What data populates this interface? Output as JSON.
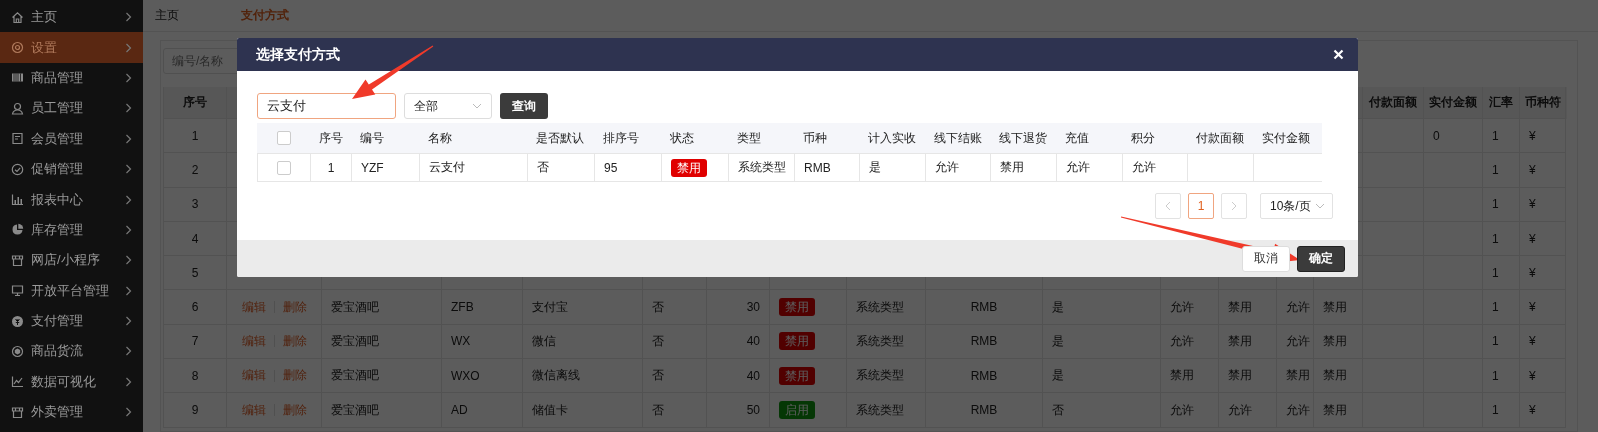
{
  "sidebar": {
    "items": [
      {
        "label": "主页",
        "selected": false
      },
      {
        "label": "设置",
        "selected": true
      },
      {
        "label": "商品管理",
        "selected": false
      },
      {
        "label": "员工管理",
        "selected": false
      },
      {
        "label": "会员管理",
        "selected": false
      },
      {
        "label": "促销管理",
        "selected": false
      },
      {
        "label": "报表中心",
        "selected": false
      },
      {
        "label": "库存管理",
        "selected": false
      },
      {
        "label": "网店/小程序",
        "selected": false
      },
      {
        "label": "开放平台管理",
        "selected": false
      },
      {
        "label": "支付管理",
        "selected": false
      },
      {
        "label": "商品货流",
        "selected": false
      },
      {
        "label": "数据可视化",
        "selected": false
      },
      {
        "label": "外卖管理",
        "selected": false
      }
    ]
  },
  "breadcrumb": [
    {
      "label": "主页",
      "current": false
    },
    {
      "label": "支付方式",
      "current": true
    }
  ],
  "filter": {
    "placeholder": "编号/名称"
  },
  "table": {
    "columns": [
      "序号",
      null,
      null,
      null,
      null,
      null,
      null,
      null,
      null,
      null,
      null,
      null,
      null,
      null,
      null,
      "付款面额",
      "实付金额",
      "汇率",
      "币种符"
    ],
    "rows": [
      {
        "cells": [
          "1",
          null,
          null,
          null,
          null,
          null,
          null,
          null,
          null,
          null,
          null,
          null,
          null,
          null,
          null,
          null,
          "0",
          "1",
          "¥"
        ]
      },
      {
        "cells": [
          "2",
          null,
          null,
          null,
          null,
          null,
          null,
          null,
          null,
          null,
          null,
          null,
          null,
          null,
          null,
          null,
          null,
          "1",
          "¥"
        ]
      },
      {
        "cells": [
          "3",
          null,
          null,
          null,
          null,
          null,
          null,
          null,
          null,
          null,
          null,
          null,
          null,
          null,
          null,
          null,
          null,
          "1",
          "¥"
        ]
      },
      {
        "cells": [
          "4",
          null,
          null,
          null,
          null,
          null,
          null,
          null,
          null,
          null,
          null,
          null,
          null,
          null,
          null,
          null,
          null,
          "1",
          "¥"
        ]
      },
      {
        "cells": [
          "5",
          null,
          null,
          null,
          null,
          null,
          null,
          null,
          null,
          null,
          null,
          null,
          null,
          null,
          null,
          null,
          null,
          "1",
          "¥"
        ]
      },
      {
        "cells": [
          "6",
          {
            "kind": "actions",
            "edit": "编辑",
            "delete": "删除"
          },
          "爱宝酒吧",
          "ZFB",
          "支付宝",
          "否",
          "30",
          {
            "kind": "status",
            "label": "禁用",
            "enabled": false
          },
          "系统类型",
          "RMB",
          "是",
          "允许",
          "禁用",
          "允许",
          "禁用",
          null,
          null,
          "1",
          "¥"
        ]
      },
      {
        "cells": [
          "7",
          {
            "kind": "actions",
            "edit": "编辑",
            "delete": "删除"
          },
          "爱宝酒吧",
          "WX",
          "微信",
          "否",
          "40",
          {
            "kind": "status",
            "label": "禁用",
            "enabled": false
          },
          "系统类型",
          "RMB",
          "是",
          "允许",
          "禁用",
          "允许",
          "禁用",
          null,
          null,
          "1",
          "¥"
        ]
      },
      {
        "cells": [
          "8",
          {
            "kind": "actions",
            "edit": "编辑",
            "delete": "删除"
          },
          "爱宝酒吧",
          "WXO",
          "微信离线",
          "否",
          "40",
          {
            "kind": "status",
            "label": "禁用",
            "enabled": false
          },
          "系统类型",
          "RMB",
          "是",
          "禁用",
          "禁用",
          "禁用",
          "禁用",
          null,
          null,
          "1",
          "¥"
        ]
      },
      {
        "cells": [
          "9",
          {
            "kind": "actions",
            "edit": "编辑",
            "delete": "删除"
          },
          "爱宝酒吧",
          "AD",
          "储值卡",
          "否",
          "50",
          {
            "kind": "status",
            "label": "启用",
            "enabled": true
          },
          "系统类型",
          "RMB",
          "否",
          "允许",
          "允许",
          "允许",
          "禁用",
          null,
          null,
          "1",
          "¥"
        ]
      }
    ]
  },
  "dialog": {
    "title": "选择支付方式",
    "search": {
      "value": "云支付"
    },
    "type_select": {
      "value": "全部"
    },
    "query_button": "查询",
    "table": {
      "columns": [
        {
          "kind": "checkbox",
          "checked": false
        },
        {
          "label": "序号"
        },
        {
          "label": "编号"
        },
        {
          "label": "名称"
        },
        {
          "label": "是否默认"
        },
        {
          "label": "排序号"
        },
        {
          "label": "状态"
        },
        {
          "label": "类型"
        },
        {
          "label": "币种"
        },
        {
          "label": "计入实收"
        },
        {
          "label": "线下结账"
        },
        {
          "label": "线下退货"
        },
        {
          "label": "充值"
        },
        {
          "label": "积分"
        },
        {
          "label": "付款面额"
        },
        {
          "label": "实付金额"
        }
      ],
      "rows": [
        {
          "cells": [
            {
              "kind": "checkbox",
              "checked": false
            },
            "1",
            "YZF",
            "云支付",
            "否",
            "95",
            {
              "kind": "status",
              "label": "禁用",
              "enabled": false
            },
            "系统类型",
            "RMB",
            "是",
            "允许",
            "禁用",
            "允许",
            "允许",
            null,
            null
          ]
        }
      ]
    },
    "pagination": {
      "pages": [
        {
          "label": "1",
          "selected": true
        }
      ],
      "page_size": "10条/页"
    },
    "buttons": [
      {
        "label": "取消",
        "kind": "secondary"
      },
      {
        "label": "确定",
        "kind": "primary"
      }
    ]
  }
}
